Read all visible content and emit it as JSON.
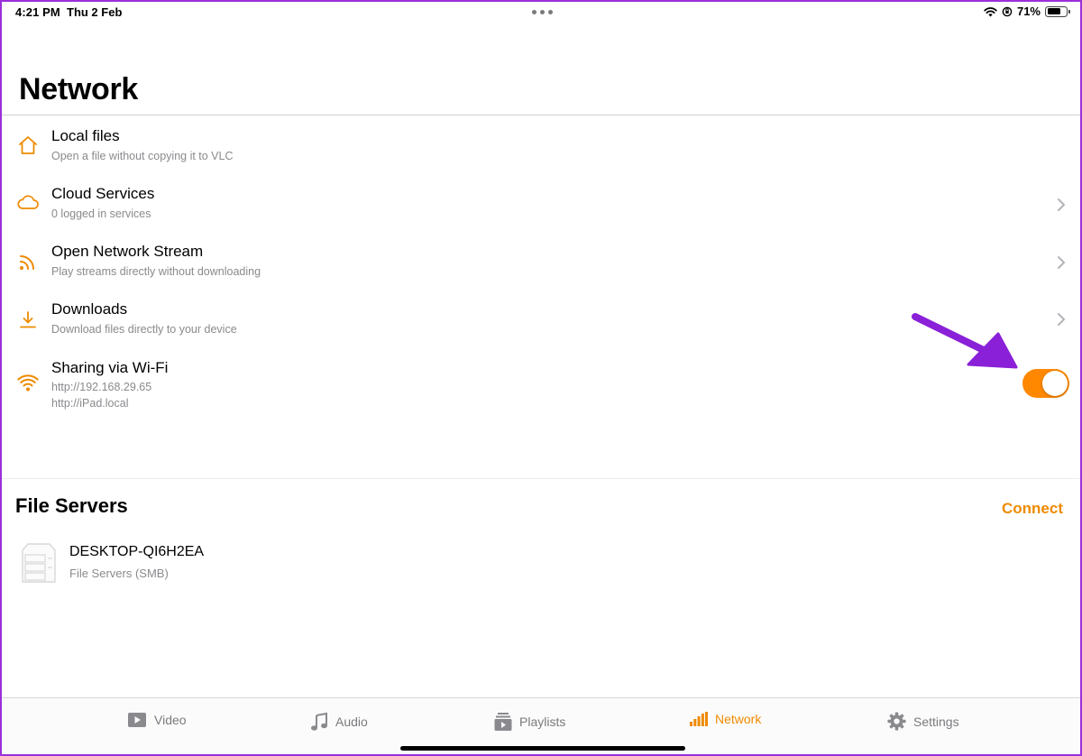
{
  "status_bar": {
    "time": "4:21 PM",
    "date": "Thu 2 Feb",
    "battery_text": "71%",
    "battery_level": 0.71
  },
  "page": {
    "title": "Network"
  },
  "items": [
    {
      "title": "Local files",
      "subtitle": "Open a file without copying it to VLC",
      "icon": "house-icon"
    },
    {
      "title": "Cloud Services",
      "subtitle": "0 logged in services",
      "icon": "cloud-icon"
    },
    {
      "title": "Open Network Stream",
      "subtitle": "Play streams directly without downloading",
      "icon": "rss-icon"
    },
    {
      "title": "Downloads",
      "subtitle": "Download files directly to your device",
      "icon": "download-icon"
    }
  ],
  "wifi_sharing": {
    "title": "Sharing via Wi-Fi",
    "url_ip": "http://192.168.29.65",
    "url_host": "http://iPad.local",
    "enabled": true
  },
  "file_servers": {
    "title": "File Servers",
    "connect_label": "Connect",
    "servers": [
      {
        "name": "DESKTOP-QI6H2EA",
        "type": "File Servers (SMB)"
      }
    ]
  },
  "tabs": [
    {
      "label": "Video",
      "icon": "play-icon",
      "active": false
    },
    {
      "label": "Audio",
      "icon": "music-note-icon",
      "active": false
    },
    {
      "label": "Playlists",
      "icon": "playlist-icon",
      "active": false
    },
    {
      "label": "Network",
      "icon": "signal-bars-icon",
      "active": true
    },
    {
      "label": "Settings",
      "icon": "gear-icon",
      "active": false
    }
  ],
  "colors": {
    "accent": "#ff8800",
    "accent_text": "#ef8a00",
    "annotation_arrow": "#8a20d8",
    "frame_border": "#9b30d9"
  }
}
